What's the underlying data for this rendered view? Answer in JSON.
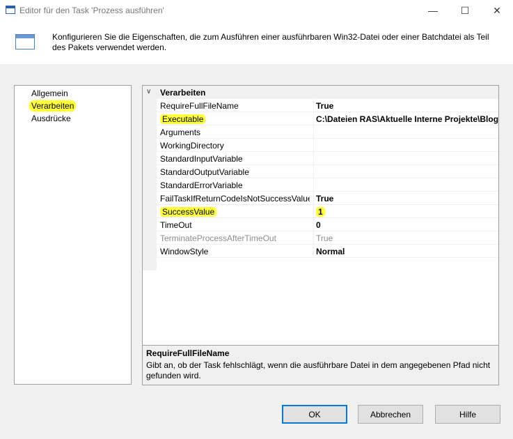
{
  "window": {
    "title": "Editor für den Task 'Prozess ausführen'",
    "minimize_glyph": "—",
    "maximize_glyph": "☐",
    "close_glyph": "✕"
  },
  "header": {
    "description": "Konfigurieren Sie die Eigenschaften, die zum Ausführen einer ausführbaren Win32-Datei oder einer Batchdatei als Teil des Pakets verwendet werden."
  },
  "nav": {
    "items": [
      {
        "label": "Allgemein",
        "highlighted": false
      },
      {
        "label": "Verarbeiten",
        "highlighted": true
      },
      {
        "label": "Ausdrücke",
        "highlighted": false
      }
    ]
  },
  "grid": {
    "category": "Verarbeiten",
    "category_chevron": "∨",
    "properties": [
      {
        "name": "RequireFullFileName",
        "value": "True",
        "highlighted": false,
        "disabled": false
      },
      {
        "name": "Executable",
        "value": "C:\\Dateien RAS\\Aktuelle Interne Projekte\\Blog",
        "highlighted": true,
        "disabled": false
      },
      {
        "name": "Arguments",
        "value": "",
        "highlighted": false,
        "disabled": false
      },
      {
        "name": "WorkingDirectory",
        "value": "",
        "highlighted": false,
        "disabled": false
      },
      {
        "name": "StandardInputVariable",
        "value": "",
        "highlighted": false,
        "disabled": false
      },
      {
        "name": "StandardOutputVariable",
        "value": "",
        "highlighted": false,
        "disabled": false
      },
      {
        "name": "StandardErrorVariable",
        "value": "",
        "highlighted": false,
        "disabled": false
      },
      {
        "name": "FailTaskIfReturnCodeIsNotSuccessValue",
        "value": "True",
        "highlighted": false,
        "disabled": false
      },
      {
        "name": "SuccessValue",
        "value": "1",
        "highlighted": true,
        "disabled": false
      },
      {
        "name": "TimeOut",
        "value": "0",
        "highlighted": false,
        "disabled": false
      },
      {
        "name": "TerminateProcessAfterTimeOut",
        "value": "True",
        "highlighted": false,
        "disabled": true
      },
      {
        "name": "WindowStyle",
        "value": "Normal",
        "highlighted": false,
        "disabled": false
      }
    ]
  },
  "description_panel": {
    "title": "RequireFullFileName",
    "text": "Gibt an, ob der Task fehlschlägt, wenn die ausführbare Datei in dem angegebenen Pfad nicht gefunden wird."
  },
  "buttons": {
    "ok": "OK",
    "cancel": "Abbrechen",
    "help": "Hilfe"
  },
  "colors": {
    "highlight": "#ffff40",
    "focus_border": "#0078d7"
  }
}
